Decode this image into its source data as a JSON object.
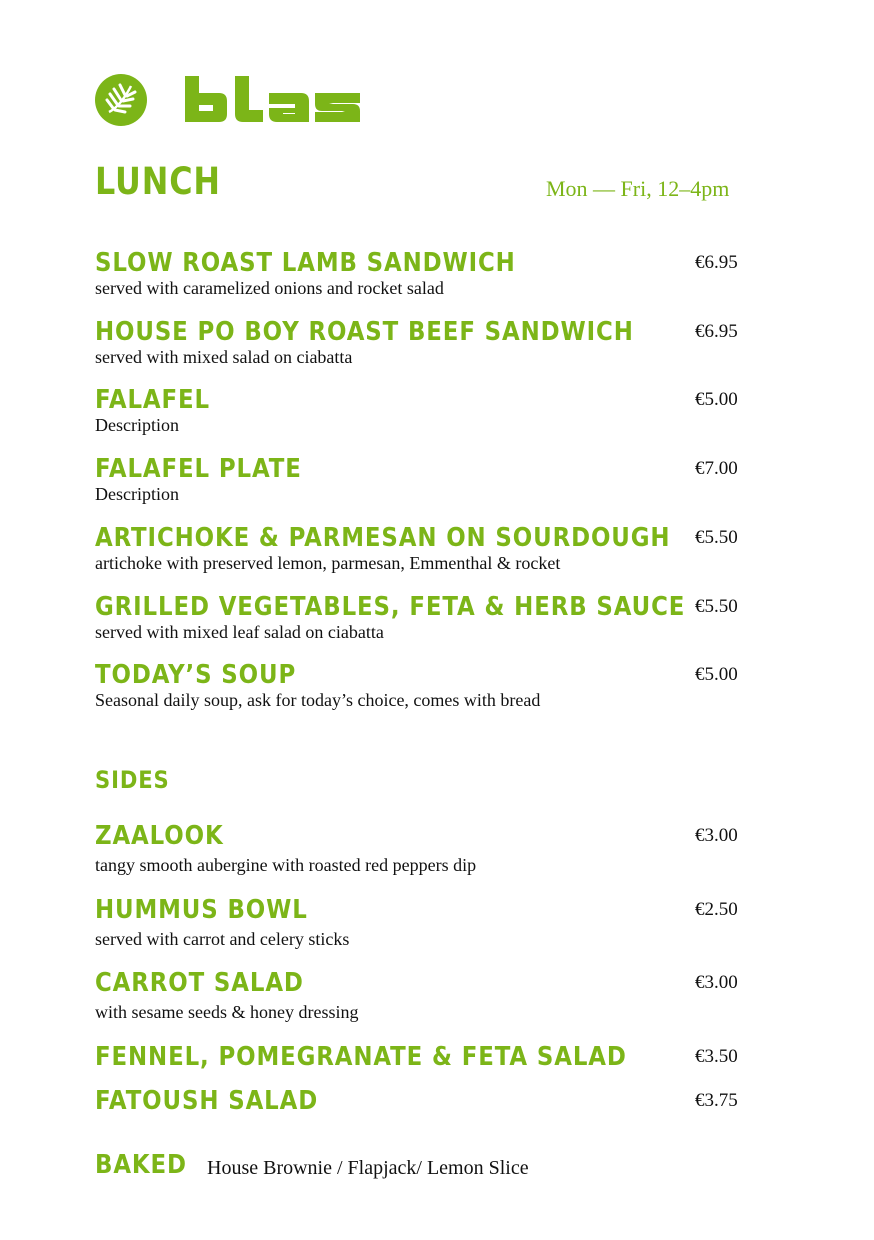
{
  "brand": {
    "name": "blas",
    "color": "#7cb518"
  },
  "lunch": {
    "title": "LUNCH",
    "hours": "Mon — Fri, 12–4pm",
    "items": [
      {
        "name": "SLOW ROAST LAMB SANDWICH",
        "desc": "served with caramelized onions and rocket salad",
        "price": "€6.95"
      },
      {
        "name": "HOUSE PO BOY ROAST BEEF SANDWICH",
        "desc": "served with mixed salad on ciabatta",
        "price": "€6.95"
      },
      {
        "name": "FALAFEL",
        "desc": "Description",
        "price": "€5.00"
      },
      {
        "name": "FALAFEL PLATE",
        "desc": "Description",
        "price": "€7.00"
      },
      {
        "name": "ARTICHOKE & PARMESAN ON SOURDOUGH",
        "desc": "artichoke with preserved lemon, parmesan, Emmenthal & rocket",
        "price": "€5.50"
      },
      {
        "name": "GRILLED VEGETABLES, FETA & HERB SAUCE",
        "desc": "served with mixed leaf salad on ciabatta",
        "price": "€5.50"
      },
      {
        "name": "TODAY’S SOUP",
        "desc": "Seasonal daily soup, ask for today’s choice, comes with bread",
        "price": "€5.00"
      }
    ]
  },
  "sides": {
    "title": "SIDES",
    "items": [
      {
        "name": "ZAALOOK",
        "desc": "tangy smooth aubergine with roasted red peppers dip",
        "price": "€3.00"
      },
      {
        "name": "HUMMUS BOWL",
        "desc": "served with carrot and celery sticks",
        "price": "€2.50"
      },
      {
        "name": "CARROT SALAD",
        "desc": "with sesame seeds & honey dressing",
        "price": "€3.00"
      },
      {
        "name": "FENNEL, POMEGRANATE & FETA SALAD",
        "desc": "",
        "price": "€3.50"
      },
      {
        "name": "FATOUSH SALAD",
        "desc": "",
        "price": "€3.75"
      }
    ]
  },
  "baked": {
    "title": "BAKED",
    "items": "House Brownie / Flapjack/ Lemon Slice"
  }
}
